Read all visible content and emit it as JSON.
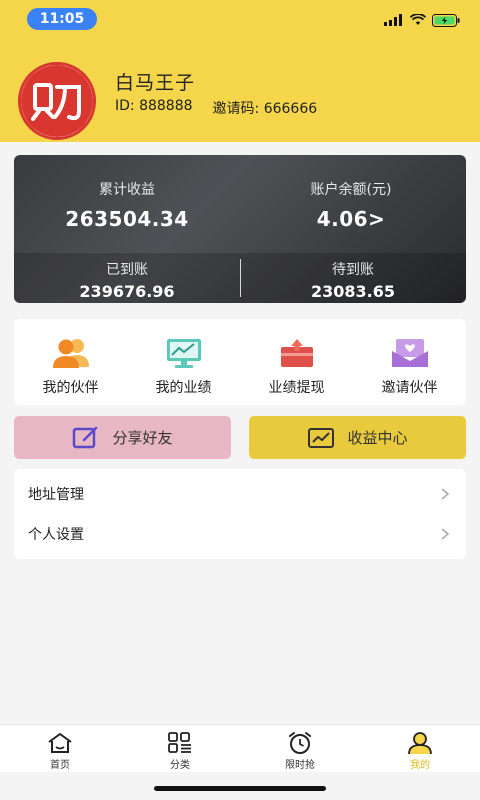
{
  "status_bar": {
    "time": "11:05"
  },
  "profile": {
    "name": "白马王子",
    "id_text": "ID: 888888",
    "invite_text": "邀请码: 666666"
  },
  "earnings": {
    "total_label": "累计收益",
    "total_value": "263504.34",
    "balance_label": "账户余额(元)",
    "balance_value": "4.06>",
    "received_label": "已到账",
    "received_value": "239676.96",
    "pending_label": "待到账",
    "pending_value": "23083.65"
  },
  "grid": [
    {
      "label": "我的伙伴",
      "icon": "partners-icon"
    },
    {
      "label": "我的业绩",
      "icon": "performance-icon"
    },
    {
      "label": "业绩提现",
      "icon": "withdraw-icon"
    },
    {
      "label": "邀请伙伴",
      "icon": "invite-icon"
    }
  ],
  "actions": {
    "share_label": "分享好友",
    "income_label": "收益中心"
  },
  "menu": [
    {
      "label": "地址管理"
    },
    {
      "label": "个人设置"
    }
  ],
  "tabs": [
    {
      "label": "首页",
      "icon": "home-icon"
    },
    {
      "label": "分类",
      "icon": "category-icon"
    },
    {
      "label": "限时抢",
      "icon": "alarm-clock-icon"
    },
    {
      "label": "我的",
      "icon": "user-icon"
    }
  ],
  "colors": {
    "header_bg": "#f5d54a",
    "accent_gold": "#e9ca3c",
    "share_pink": "#e7b7c4",
    "card_dark": "#3a3b3e",
    "logo_red": "#d8362f"
  }
}
